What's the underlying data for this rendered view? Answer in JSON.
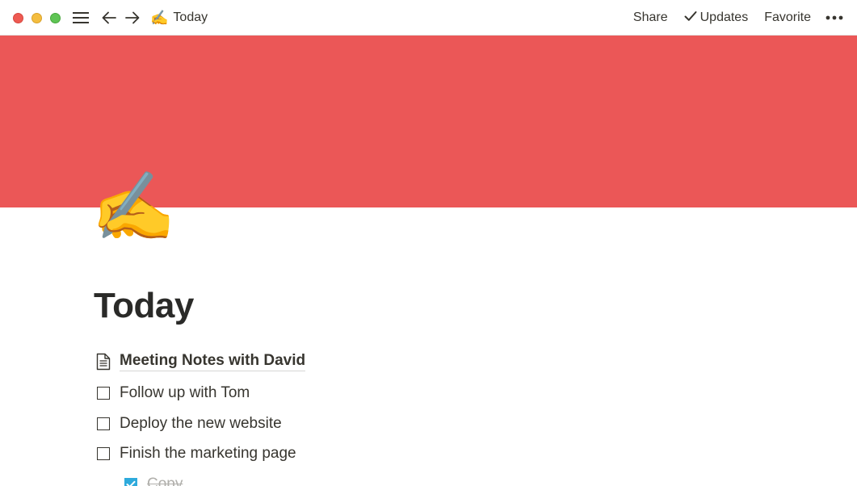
{
  "window": {
    "buttons": [
      "close",
      "minimize",
      "maximize"
    ]
  },
  "titlebar": {
    "menu_icon": "hamburger-menu-icon",
    "back_icon": "arrow-left-icon",
    "forward_icon": "arrow-right-icon",
    "breadcrumb": {
      "emoji": "✍️",
      "label": "Today"
    },
    "actions": {
      "share": "Share",
      "updates": "Updates",
      "favorite": "Favorite",
      "more_icon": "more-horizontal-icon"
    }
  },
  "page": {
    "cover_color": "#eb5757",
    "icon": "✍️",
    "title": "Today",
    "blocks": [
      {
        "type": "page-link",
        "icon": "document-icon",
        "label": "Meeting Notes with David"
      },
      {
        "type": "todo",
        "checked": false,
        "label": "Follow up with Tom"
      },
      {
        "type": "todo",
        "checked": false,
        "label": "Deploy the new website"
      },
      {
        "type": "todo",
        "checked": false,
        "label": "Finish the marketing page"
      },
      {
        "type": "todo",
        "checked": true,
        "label": "Copy",
        "nested": true
      }
    ]
  },
  "colors": {
    "text": "#37352f",
    "cover": "#eb5757",
    "checkbox_checked": "#2eaadc"
  }
}
